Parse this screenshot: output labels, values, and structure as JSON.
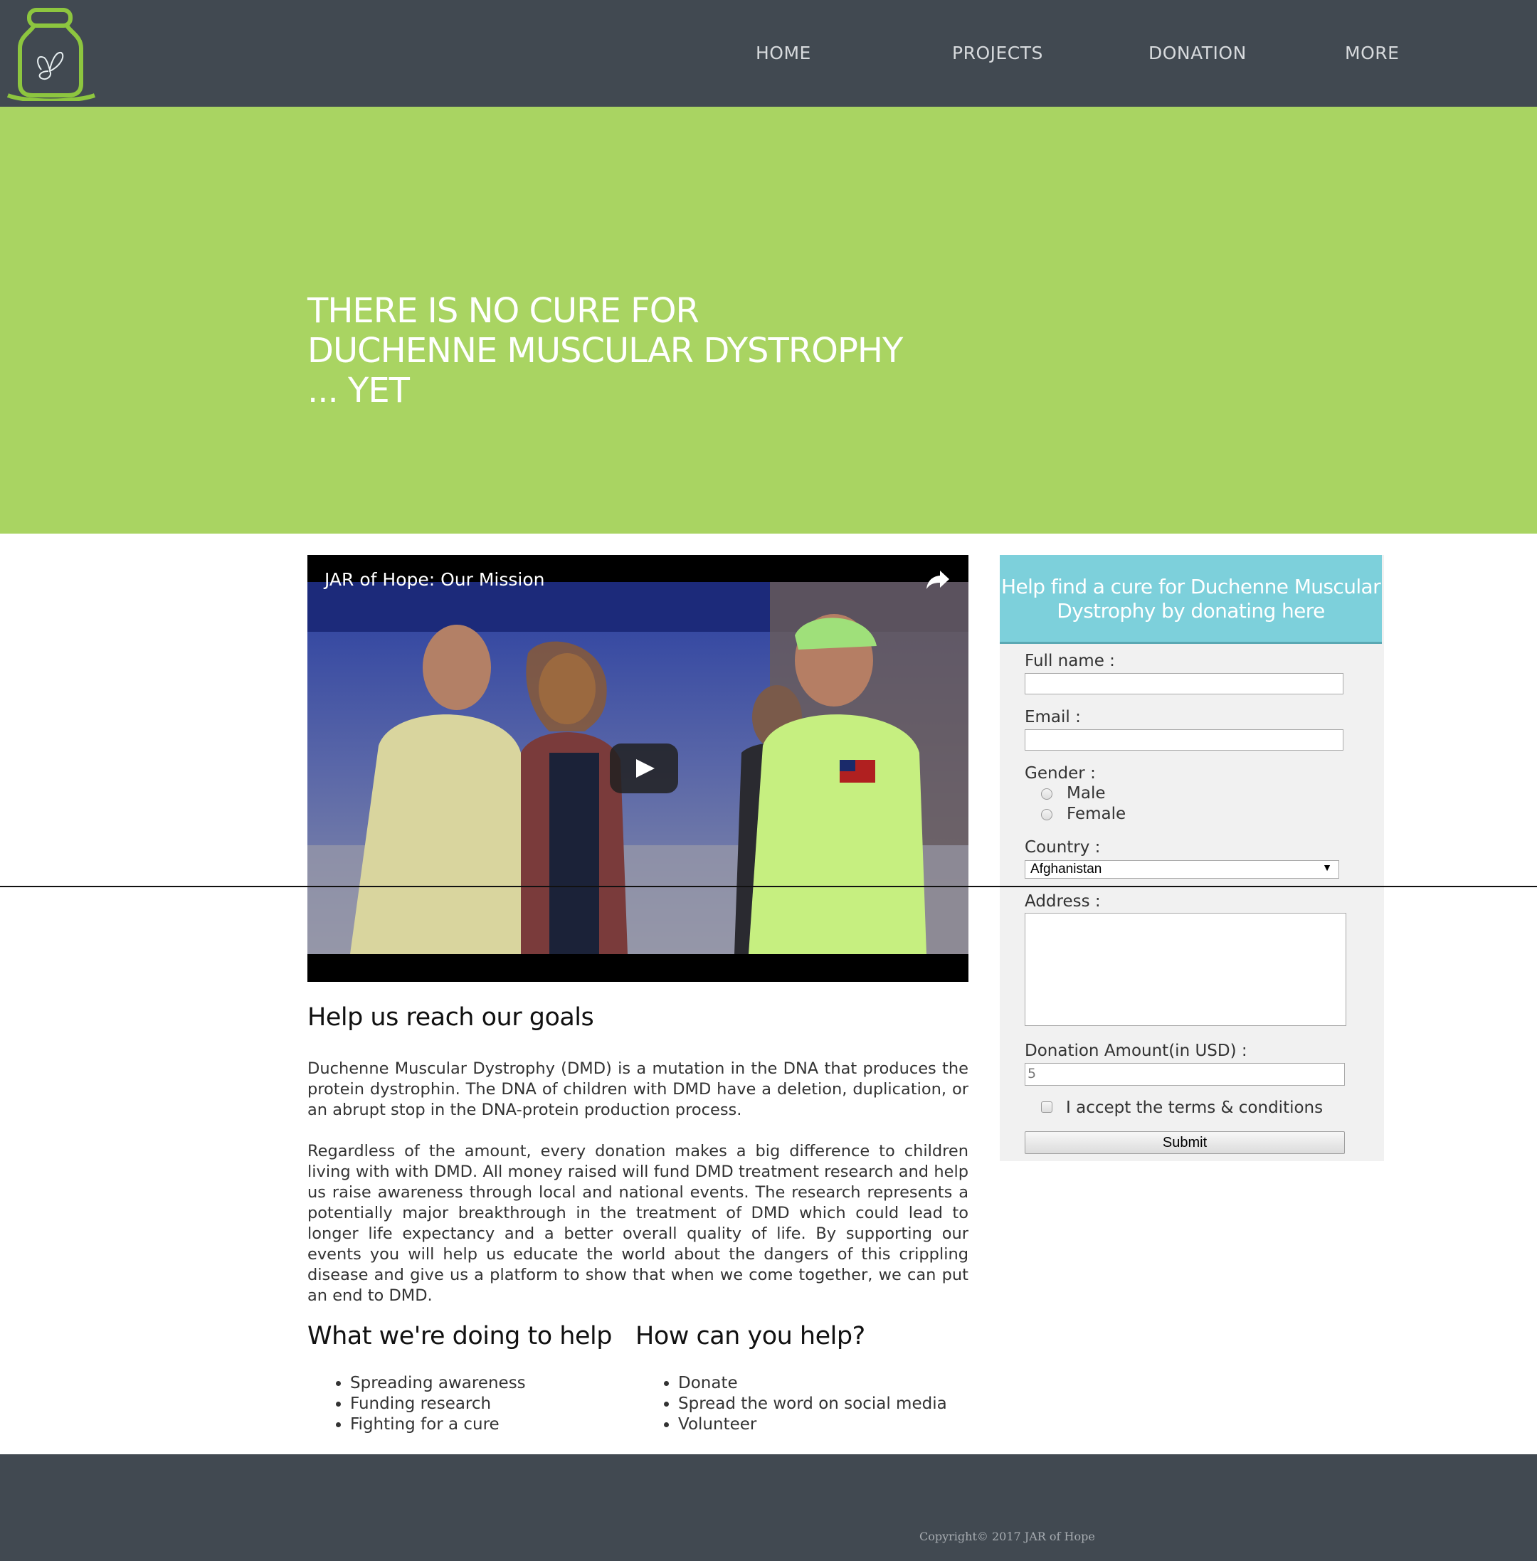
{
  "colors": {
    "nav_bg": "#414951",
    "hero_bg": "#a9d462",
    "form_header_bg": "#7dd0db",
    "form_bg": "#f1f1f1",
    "logo_stroke": "#8dc63f"
  },
  "logo": {
    "icon": "jar-butterfly-logo"
  },
  "nav": {
    "items": [
      {
        "label": "HOME"
      },
      {
        "label": "PROJECTS"
      },
      {
        "label": "DONATION"
      },
      {
        "label": "MORE"
      }
    ]
  },
  "hero": {
    "line1": "THERE IS NO CURE FOR",
    "line2": "DUCHENNE MUSCULAR DYSTROPHY",
    "line3": "... YET"
  },
  "video": {
    "title": "JAR of Hope: Our Mission",
    "share_icon": "share-arrow-icon",
    "play_icon": "play-icon"
  },
  "article": {
    "heading": "Help us reach our goals",
    "para1": "Duchenne Muscular Dystrophy (DMD) is a mutation in the DNA that produces the protein dystrophin. The DNA of children with DMD have a deletion, duplication, or an abrupt stop in the DNA-protein production process.",
    "para2": "Regardless of the amount, every donation makes a big difference to children living with with DMD. All money raised will fund DMD treatment research and help us raise awareness through local and national events. The research represents a potentially major breakthrough in the treatment of DMD which could lead to longer life expectancy and a better overall quality of life. By supporting our events you will help us educate the world about the dangers of this crippling disease and give us a platform to show that when we come together, we can put an end to DMD."
  },
  "columns": {
    "doing": {
      "heading": "What we're doing to help",
      "items": [
        "Spreading awareness",
        "Funding research",
        "Fighting for a cure"
      ]
    },
    "you": {
      "heading": "How can you help?",
      "items": [
        "Donate",
        "Spread the word on social media",
        "Volunteer"
      ]
    }
  },
  "form": {
    "header": "Help find a cure for Duchenne Muscular Dystrophy by donating here",
    "fullname_label": "Full name :",
    "fullname_value": "",
    "email_label": "Email :",
    "email_value": "",
    "gender_label": "Gender :",
    "gender_options": [
      "Male",
      "Female"
    ],
    "country_label": "Country :",
    "country_value": "Afghanistan",
    "address_label": "Address :",
    "address_value": "",
    "amount_label": "Donation Amount(in USD) :",
    "amount_placeholder": "5",
    "terms_label": "I accept the terms & conditions",
    "submit_label": "Submit"
  },
  "footer": {
    "copyright": "Copyright© 2017 JAR of Hope"
  }
}
